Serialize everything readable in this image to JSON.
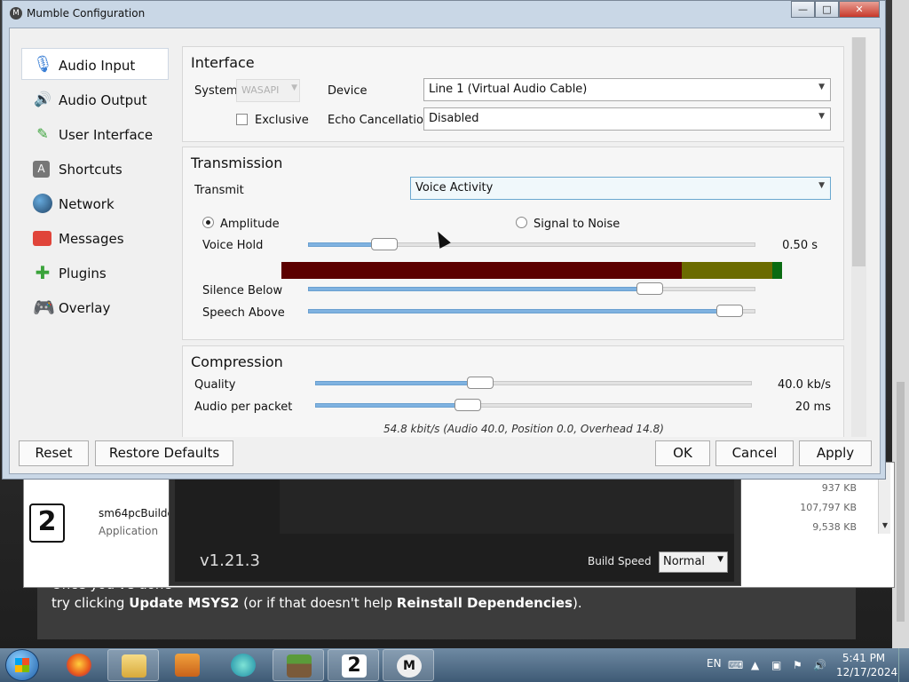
{
  "window": {
    "title": "Mumble Configuration",
    "controls": [
      "minimize",
      "maximize",
      "close"
    ]
  },
  "sidebar": {
    "items": [
      {
        "label": "Audio Input",
        "icon": "microphone-icon",
        "active": true
      },
      {
        "label": "Audio Output",
        "icon": "speaker-icon",
        "active": false
      },
      {
        "label": "User Interface",
        "icon": "brush-icon",
        "active": false
      },
      {
        "label": "Shortcuts",
        "icon": "key-icon",
        "active": false
      },
      {
        "label": "Network",
        "icon": "globe-icon",
        "active": false
      },
      {
        "label": "Messages",
        "icon": "message-icon",
        "active": false
      },
      {
        "label": "Plugins",
        "icon": "puzzle-icon",
        "active": false
      },
      {
        "label": "Overlay",
        "icon": "gamepad-icon",
        "active": false
      }
    ]
  },
  "interface": {
    "title": "Interface",
    "system_label": "System",
    "system_value": "WASAPI",
    "device_label": "Device",
    "device_value": "Line 1 (Virtual Audio Cable)",
    "exclusive_label": "Exclusive",
    "exclusive_checked": false,
    "echo_label": "Echo Cancellation",
    "echo_value": "Disabled"
  },
  "transmission": {
    "title": "Transmission",
    "transmit_label": "Transmit",
    "transmit_value": "Voice Activity",
    "amplitude_label": "Amplitude",
    "amplitude_selected": true,
    "snr_label": "Signal to Noise",
    "snr_selected": false,
    "voice_hold_label": "Voice Hold",
    "voice_hold_value": "0.50 s",
    "voice_hold_fraction": 0.15,
    "meter": {
      "red": 0.8,
      "yellow": 0.18,
      "green": 0.02
    },
    "silence_below_label": "Silence Below",
    "silence_below_fraction": 0.78,
    "speech_above_label": "Speech Above",
    "speech_above_fraction": 0.97
  },
  "compression": {
    "title": "Compression",
    "quality_label": "Quality",
    "quality_value": "40.0 kb/s",
    "quality_fraction": 0.37,
    "packet_label": "Audio per packet",
    "packet_value": "20 ms",
    "packet_fraction": 0.34,
    "info": "54.8 kbit/s (Audio 40.0, Position 0.0, Overhead 14.8)"
  },
  "buttons": {
    "reset": "Reset",
    "restore": "Restore Defaults",
    "ok": "OK",
    "cancel": "Cancel",
    "apply": "Apply"
  },
  "explorer": {
    "file_name": "sm64pcBuilde",
    "file_type": "Application",
    "sizes": [
      "937 KB",
      "107,797 KB",
      "9,538 KB"
    ]
  },
  "builder": {
    "version": "v1.21.3",
    "build_speed_label": "Build Speed",
    "build_speed_value": "Normal"
  },
  "guide": {
    "line1": "Once you've done",
    "line2_prefix": "try clicking ",
    "line2_bold1": "Update MSYS2",
    "line2_mid": " (or if that doesn't help ",
    "line2_bold2": "Reinstall Dependencies",
    "line2_suffix": ")."
  },
  "taskbar": {
    "language": "EN",
    "time": "5:41 PM",
    "date": "12/17/2024",
    "apps": [
      "firefox-icon",
      "explorer-folder-icon",
      "media-player-icon",
      "browser-icon",
      "minecraft-icon",
      "sm64-builder-icon",
      "mumble-icon"
    ]
  }
}
